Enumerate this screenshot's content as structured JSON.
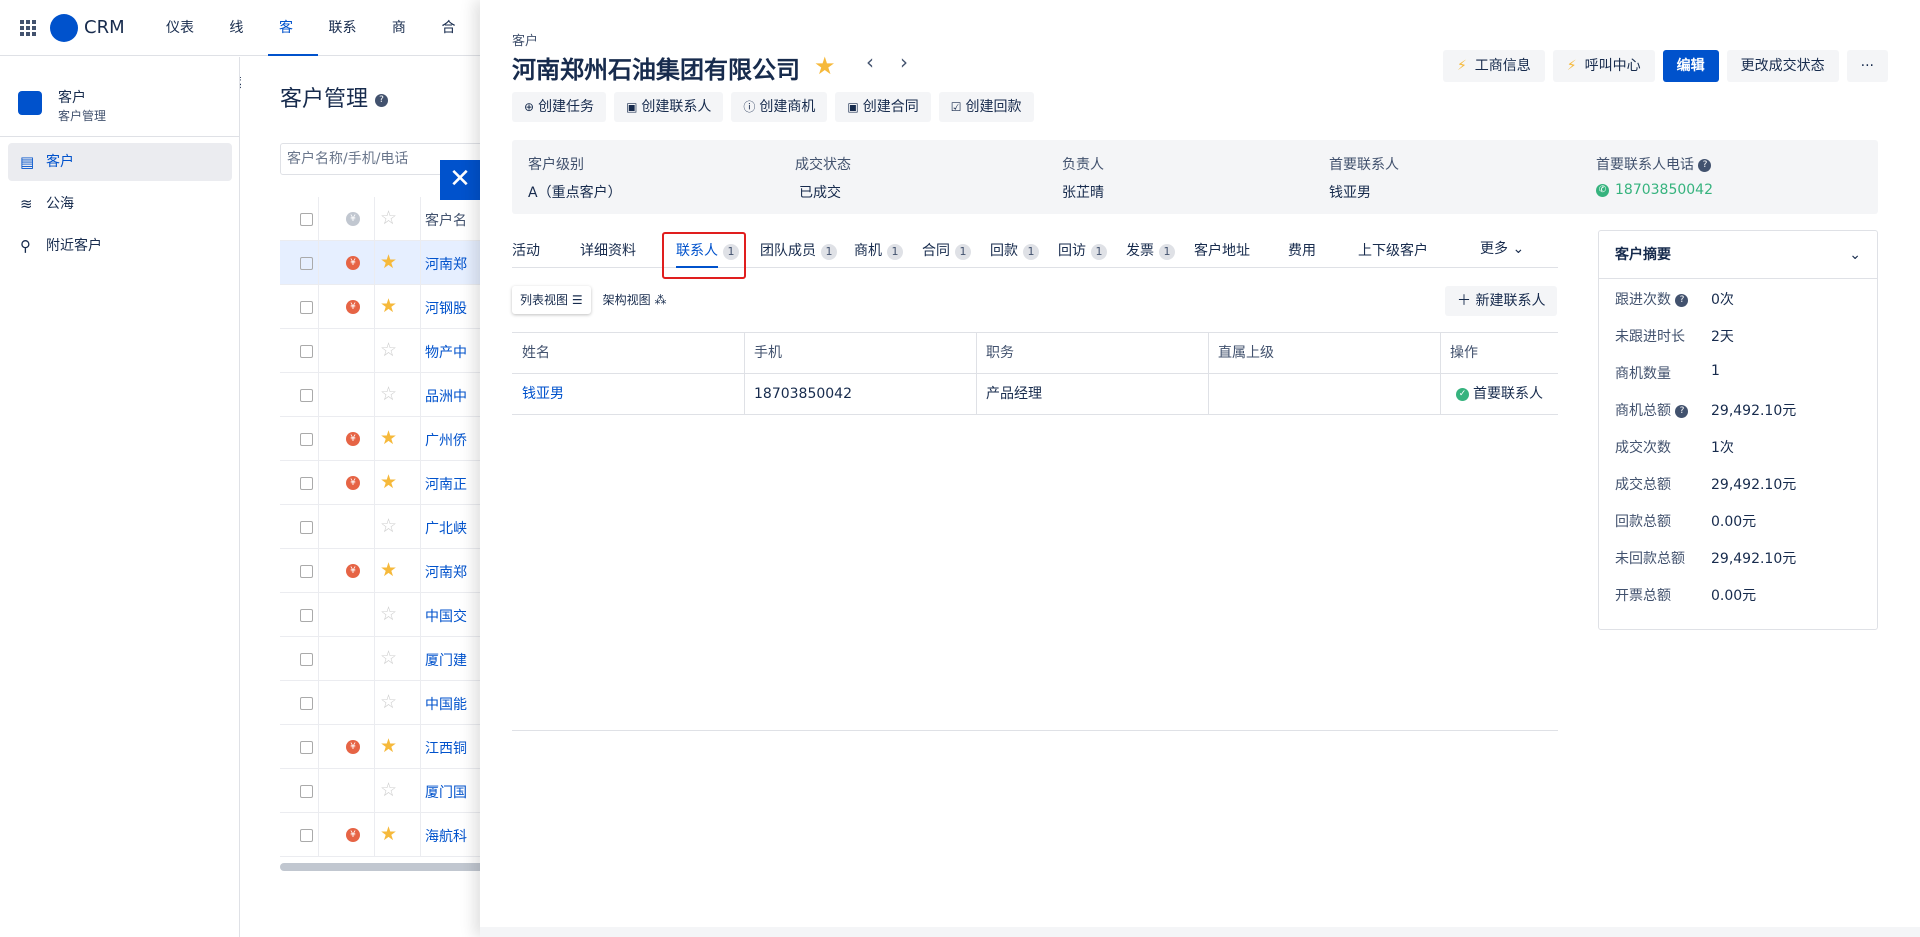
{
  "topnav": {
    "brand": "CRM",
    "items": [
      "仪表盘",
      "线索",
      "客户",
      "联系人",
      "商机",
      "合同"
    ],
    "active_index": 2
  },
  "sidebar": {
    "module_title": "客户",
    "module_subtitle": "客户管理",
    "items": [
      {
        "label": "客户",
        "icon": "building-icon",
        "active": true
      },
      {
        "label": "公海",
        "icon": "waves-icon",
        "active": false
      },
      {
        "label": "附近客户",
        "icon": "location-pin-icon",
        "active": false
      }
    ]
  },
  "list": {
    "title": "客户管理",
    "search_placeholder": "客户名称/手机/电话",
    "header_name": "客户名",
    "rows": [
      {
        "name": "河南郑州石油集团有限公司",
        "badge": true,
        "starred": true,
        "selected": true
      },
      {
        "name": "河钢股份",
        "badge": true,
        "starred": true,
        "selected": false
      },
      {
        "name": "物产中大",
        "badge": false,
        "starred": false,
        "selected": false
      },
      {
        "name": "品洲中",
        "badge": false,
        "starred": false,
        "selected": false
      },
      {
        "name": "广州侨",
        "badge": true,
        "starred": true,
        "selected": false
      },
      {
        "name": "河南正",
        "badge": true,
        "starred": true,
        "selected": false
      },
      {
        "name": "广北峡",
        "badge": false,
        "starred": false,
        "selected": false
      },
      {
        "name": "河南郑",
        "badge": true,
        "starred": true,
        "selected": false
      },
      {
        "name": "中国交",
        "badge": false,
        "starred": false,
        "selected": false
      },
      {
        "name": "厦门建",
        "badge": false,
        "starred": false,
        "selected": false
      },
      {
        "name": "中国能",
        "badge": false,
        "starred": false,
        "selected": false
      },
      {
        "name": "江西铜",
        "badge": true,
        "starred": true,
        "selected": false
      },
      {
        "name": "厦门国",
        "badge": false,
        "starred": false,
        "selected": false
      },
      {
        "name": "海航科",
        "badge": true,
        "starred": true,
        "selected": false
      }
    ]
  },
  "drawer": {
    "breadcrumb": "客户",
    "title": "河南郑州石油集团有限公司",
    "actions": [
      {
        "label": "创建任务",
        "icon": "plus-circle-icon"
      },
      {
        "label": "创建联系人",
        "icon": "clipboard-icon"
      },
      {
        "label": "创建商机",
        "icon": "info-circle-icon"
      },
      {
        "label": "创建合同",
        "icon": "clipboard-icon"
      },
      {
        "label": "创建回款",
        "icon": "check-clipboard-icon"
      }
    ],
    "top_buttons": {
      "business_info": "工商信息",
      "call_center": "呼叫中心",
      "edit": "编辑",
      "change_status": "更改成交状态",
      "more": "···"
    },
    "info": [
      {
        "label": "客户级别",
        "value": "A（重点客户）"
      },
      {
        "label": "成交状态",
        "value": "已成交"
      },
      {
        "label": "负责人",
        "value": "张芷晴"
      },
      {
        "label": "首要联系人",
        "value": "钱亚男"
      },
      {
        "label": "首要联系人电话",
        "value": "18703850042"
      }
    ],
    "tabs": [
      {
        "label": "活动",
        "count": ""
      },
      {
        "label": "详细资料",
        "count": ""
      },
      {
        "label": "联系人",
        "count": "1"
      },
      {
        "label": "团队成员",
        "count": "1"
      },
      {
        "label": "商机",
        "count": "1"
      },
      {
        "label": "合同",
        "count": "1"
      },
      {
        "label": "回款",
        "count": "1"
      },
      {
        "label": "回访",
        "count": "1"
      },
      {
        "label": "发票",
        "count": "1"
      },
      {
        "label": "客户地址",
        "count": ""
      },
      {
        "label": "费用",
        "count": ""
      },
      {
        "label": "上下级客户",
        "count": ""
      },
      {
        "label": "更多",
        "count": ""
      }
    ],
    "view_list": "列表视图",
    "view_org": "架构视图",
    "new_contact": "新建联系人",
    "table": {
      "columns": [
        "姓名",
        "手机",
        "职务",
        "直属上级",
        "操作"
      ],
      "rows": [
        {
          "name": "钱亚男",
          "phone": "18703850042",
          "title": "产品经理",
          "superior": "",
          "op": "首要联系人"
        }
      ]
    },
    "summary": {
      "title": "客户摘要",
      "rows": [
        {
          "label": "跟进次数",
          "value": "0次",
          "help": true
        },
        {
          "label": "未跟进时长",
          "value": "2天",
          "help": false
        },
        {
          "label": "商机数量",
          "value": "1",
          "help": false
        },
        {
          "label": "商机总额",
          "value": "29,492.10元",
          "help": true
        },
        {
          "label": "成交次数",
          "value": "1次",
          "help": false
        },
        {
          "label": "成交总额",
          "value": "29,492.10元",
          "help": false
        },
        {
          "label": "回款总额",
          "value": "0.00元",
          "help": false
        },
        {
          "label": "未回款总额",
          "value": "29,492.10元",
          "help": false
        },
        {
          "label": "开票总额",
          "value": "0.00元",
          "help": false
        }
      ]
    }
  },
  "colors": {
    "accent": "#0052cc",
    "star": "#f6b93b",
    "badge": "#e66445",
    "success": "#36b37e",
    "highlight": "#e01e1e"
  }
}
